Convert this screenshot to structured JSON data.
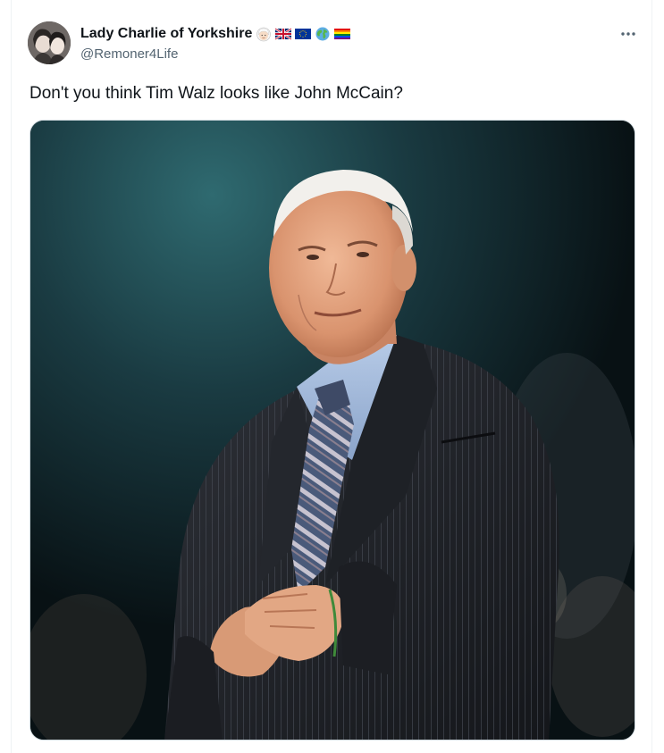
{
  "post": {
    "author": {
      "display_name": "Lady Charlie of Yorkshire",
      "handle": "@Remoner4Life",
      "name_emojis": [
        "woman-white-hair-emoji",
        "union-jack-flag-emoji",
        "eu-flag-emoji",
        "globe-emoji",
        "rainbow-flag-emoji"
      ]
    },
    "text": "Don't you think Tim Walz looks like John McCain?",
    "more_icon": "more-horizontal-icon",
    "media": {
      "type": "photo",
      "subject": "man in dark pinstripe suit, light blue shirt and striped tie, hands clasped, looking upward"
    }
  },
  "colors": {
    "text_primary": "#0f1419",
    "text_secondary": "#536471",
    "border": "#eff3f4"
  }
}
